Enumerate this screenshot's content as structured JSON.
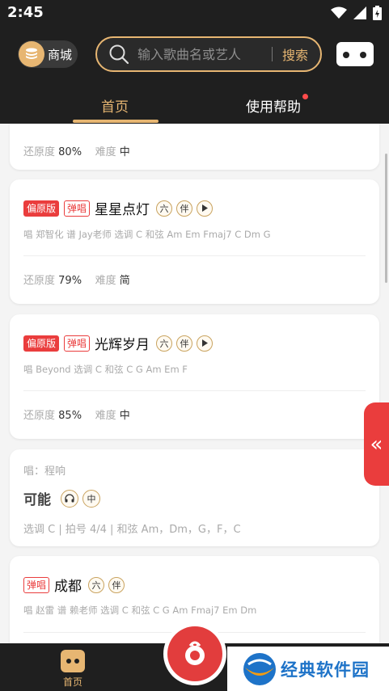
{
  "status_bar": {
    "time": "2:45"
  },
  "header": {
    "mall_label": "商城",
    "search_placeholder": "输入歌曲名或艺人",
    "search_button": "搜索"
  },
  "tabs": [
    {
      "label": "首页",
      "active": true
    },
    {
      "label": "使用帮助",
      "has_dot": true
    }
  ],
  "cards": [
    {
      "fidelity_label": "还原度",
      "fidelity": "80%",
      "difficulty_label": "难度",
      "difficulty": "中"
    },
    {
      "tag1": "偏原版",
      "tag2": "弹唱",
      "title": "星星点灯",
      "badges": [
        "六",
        "伴"
      ],
      "info": "唱 郑智化 谱 Jay老师 选调 C 和弦 Am Em Fmaj7 C Dm G",
      "fidelity_label": "还原度",
      "fidelity": "79%",
      "difficulty_label": "难度",
      "difficulty": "简"
    },
    {
      "tag1": "偏原版",
      "tag2": "弹唱",
      "title": "光辉岁月",
      "badges": [
        "六",
        "伴"
      ],
      "info": "唱 Beyond 选调 C 和弦 C G Am Em F",
      "fidelity_label": "还原度",
      "fidelity": "85%",
      "difficulty_label": "难度",
      "difficulty": "中"
    },
    {
      "singer": "唱：程响",
      "title": "可能",
      "badge": "中",
      "info": "选调 C | 拍号 4/4 | 和弦 Am，Dm，G，F，C"
    },
    {
      "tag2": "弹唱",
      "title": "成都",
      "badges": [
        "六",
        "伴"
      ],
      "info": "唱 赵雷 谱 赖老师 选调 C 和弦 C G Am Fmaj7 Em Dm"
    }
  ],
  "side_tab": "«",
  "bottom_nav": {
    "home_label": "首页"
  },
  "watermark": "经典软件园",
  "colors": {
    "accent": "#e7b672",
    "red": "#ea3d3d",
    "dark": "#1f1f1f"
  }
}
